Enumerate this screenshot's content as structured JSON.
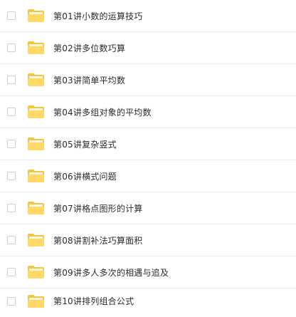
{
  "colors": {
    "folder_back": "#f5c542",
    "folder_front": "#ffd866",
    "folder_tab": "#f7cd4c",
    "text": "#2b2b2b",
    "checkbox_border": "#cfcfcf"
  },
  "items": [
    {
      "label": "第01讲小数的运算技巧",
      "icon": "folder-icon"
    },
    {
      "label": "第02讲多位数巧算",
      "icon": "folder-icon"
    },
    {
      "label": "第03讲简单平均数",
      "icon": "folder-icon"
    },
    {
      "label": "第04讲多组对象的平均数",
      "icon": "folder-icon"
    },
    {
      "label": "第05讲复杂竖式",
      "icon": "folder-icon"
    },
    {
      "label": "第06讲横式问题",
      "icon": "folder-icon"
    },
    {
      "label": "第07讲格点图形的计算",
      "icon": "folder-icon"
    },
    {
      "label": "第08讲割补法巧算面积",
      "icon": "folder-icon"
    },
    {
      "label": "第09讲多人多次的相遇与追及",
      "icon": "folder-icon"
    },
    {
      "label": "第10讲排列组合公式",
      "icon": "folder-icon"
    }
  ]
}
